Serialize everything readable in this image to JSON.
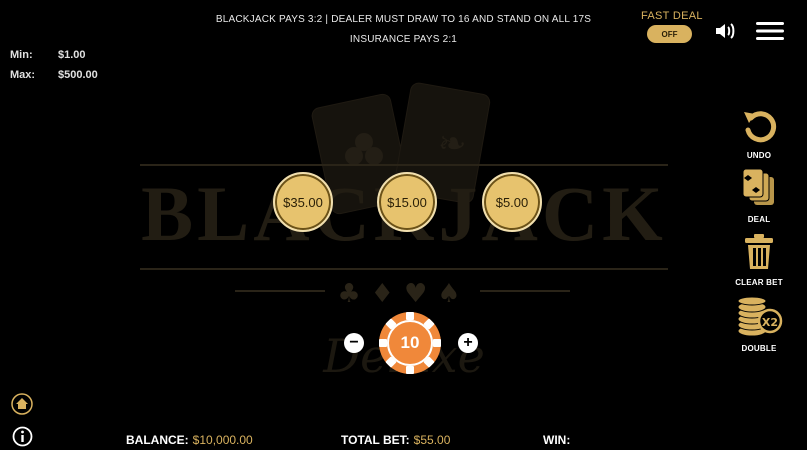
{
  "rules": {
    "line1": "BLACKJACK PAYS 3:2 | DEALER MUST DRAW TO 16 AND STAND ON ALL 17S",
    "line2": "INSURANCE PAYS 2:1"
  },
  "limits": {
    "min_label": "Min:",
    "min_value": "$1.00",
    "max_label": "Max:",
    "max_value": "$500.00"
  },
  "fast_deal": {
    "label": "FAST DEAL",
    "toggle": "OFF"
  },
  "bet_spots": [
    "$35.00",
    "$15.00",
    "$5.00"
  ],
  "chip": {
    "value": "10",
    "color": "#f0883a"
  },
  "actions": {
    "undo": "UNDO",
    "deal": "DEAL",
    "clear_bet": "CLEAR BET",
    "double": "DOUBLE"
  },
  "bottom": {
    "balance_label": "BALANCE:",
    "balance_value": "$10,000.00",
    "total_bet_label": "TOTAL BET:",
    "total_bet_value": "$55.00",
    "win_label": "WIN:",
    "win_value": ""
  },
  "colors": {
    "gold": "#d9b25f",
    "chip_orange": "#f0883a",
    "watermark": "#2a2418"
  },
  "icons": {
    "undo": "undo-arrow-icon",
    "deal": "cards-icon",
    "clear_bet": "trash-icon",
    "double": "chips-x2-icon",
    "sound": "speaker-icon",
    "menu": "hamburger-icon",
    "home": "home-icon",
    "info": "info-icon"
  }
}
